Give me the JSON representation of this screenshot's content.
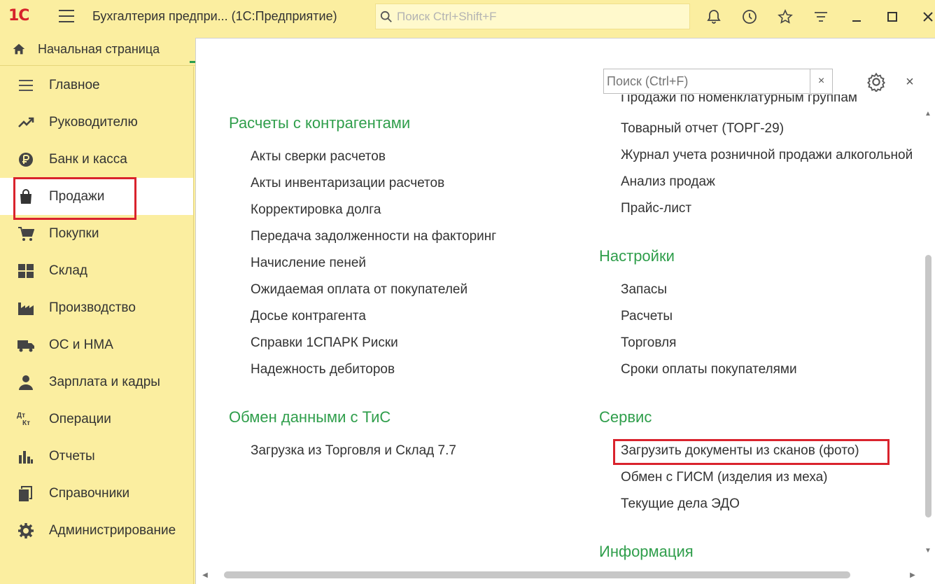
{
  "app": {
    "logo": "1С",
    "title": "Бухгалтерия предпри...  (1С:Предприятие)",
    "search_placeholder": "Поиск Ctrl+Shift+F"
  },
  "home_tab": {
    "label": "Начальная страница"
  },
  "sidebar": {
    "items": [
      {
        "label": "Главное",
        "icon": "menu-lines-icon"
      },
      {
        "label": "Руководителю",
        "icon": "trend-up-icon"
      },
      {
        "label": "Банк и касса",
        "icon": "ruble-coin-icon"
      },
      {
        "label": "Продажи",
        "icon": "shopping-bag-icon",
        "active": true
      },
      {
        "label": "Покупки",
        "icon": "cart-icon"
      },
      {
        "label": "Склад",
        "icon": "warehouse-grid-icon"
      },
      {
        "label": "Производство",
        "icon": "factory-icon"
      },
      {
        "label": "ОС и НМА",
        "icon": "truck-icon"
      },
      {
        "label": "Зарплата и кадры",
        "icon": "person-icon"
      },
      {
        "label": "Операции",
        "icon": "debit-credit-icon",
        "icon_text": [
          "Дт",
          "Кт"
        ]
      },
      {
        "label": "Отчеты",
        "icon": "bar-chart-icon"
      },
      {
        "label": "Справочники",
        "icon": "books-icon"
      },
      {
        "label": "Администрирование",
        "icon": "gear-icon"
      }
    ]
  },
  "panel": {
    "search_placeholder": "Поиск (Ctrl+F)",
    "clear_label": "×",
    "close_label": "×",
    "left": {
      "sections": [
        {
          "title": "Расчеты с контрагентами",
          "links": [
            "Акты сверки расчетов",
            "Акты инвентаризации расчетов",
            "Корректировка долга",
            "Передача задолженности на факторинг",
            "Начисление пеней",
            "Ожидаемая оплата от покупателей",
            "Досье контрагента",
            "Справки 1СПАРК Риски",
            "Надежность дебиторов"
          ]
        },
        {
          "title": "Обмен данными с ТиС",
          "links": [
            "Загрузка из Торговля и Склад 7.7"
          ]
        }
      ]
    },
    "right": {
      "cut_link": "Продажи по номенклатурным группам",
      "top_links": [
        "Товарный отчет (ТОРГ-29)",
        "Журнал учета розничной продажи алкогольной",
        "Анализ продаж",
        "Прайс-лист"
      ],
      "sections": [
        {
          "title": "Настройки",
          "links": [
            "Запасы",
            "Расчеты",
            "Торговля",
            "Сроки оплаты покупателями"
          ]
        },
        {
          "title": "Сервис",
          "links": [
            "Загрузить документы из сканов (фото)",
            "Обмен с ГИСМ (изделия из меха)",
            "Текущие дела ЭДО"
          ]
        },
        {
          "title": "Информация",
          "links": []
        }
      ]
    }
  },
  "colors": {
    "background": "#fbeea0",
    "section_title": "#2f9e4b",
    "highlight": "#d9232d",
    "logo": "#d6222a"
  }
}
